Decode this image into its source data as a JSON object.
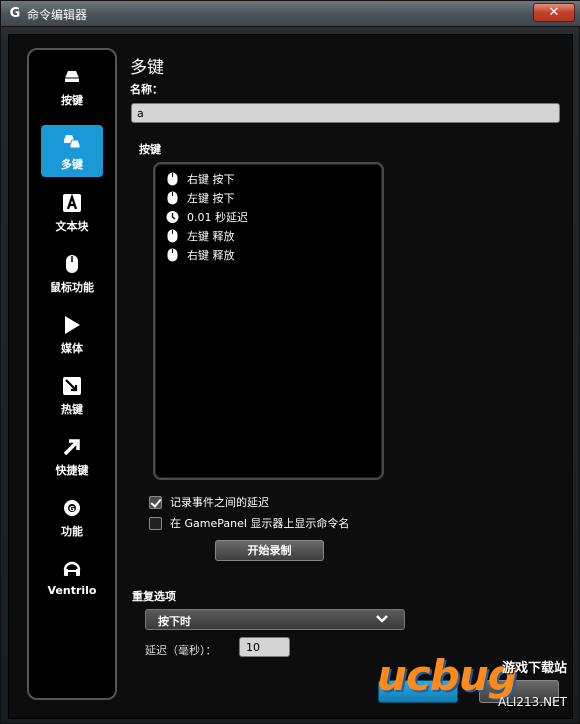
{
  "window": {
    "title": "命令编辑器",
    "close": "✕"
  },
  "sidebar": {
    "items": [
      {
        "label": "按键",
        "icon": "key-icon"
      },
      {
        "label": "多键",
        "icon": "multikey-icon",
        "active": true
      },
      {
        "label": "文本块",
        "icon": "text-block-icon"
      },
      {
        "label": "鼠标功能",
        "icon": "mouse-icon"
      },
      {
        "label": "媒体",
        "icon": "play-icon"
      },
      {
        "label": "热键",
        "icon": "hotkey-icon"
      },
      {
        "label": "快捷键",
        "icon": "shortcut-arrow-icon"
      },
      {
        "label": "功能",
        "icon": "function-gear-icon"
      },
      {
        "label": "Ventrilo",
        "icon": "headset-icon"
      }
    ]
  },
  "main": {
    "title": "多键",
    "name_label": "名称：",
    "name_value": "a",
    "keys_label": "按键",
    "key_events": [
      {
        "icon": "mouse-icon",
        "text": "右键 按下"
      },
      {
        "icon": "mouse-icon",
        "text": "左键 按下"
      },
      {
        "icon": "clock-icon",
        "text": "0.01 秒延迟"
      },
      {
        "icon": "mouse-icon",
        "text": "左键 释放"
      },
      {
        "icon": "mouse-icon",
        "text": "右键 释放"
      }
    ],
    "record_delays": {
      "label": "记录事件之间的延迟",
      "checked": true
    },
    "show_on_gamepanel": {
      "label": "在 GamePanel 显示器上显示命令名",
      "checked": false
    },
    "record_button": "开始录制",
    "repeat": {
      "label": "重复选项",
      "selected": "按下时",
      "delay_label": "延迟（毫秒）：",
      "delay_value": "10"
    }
  },
  "watermark": {
    "logo": "ucbug",
    "text": "游戏下载站",
    "url": "ALI213.NET"
  },
  "colors": {
    "accent": "#199ad6",
    "window_bg": "#000000"
  }
}
